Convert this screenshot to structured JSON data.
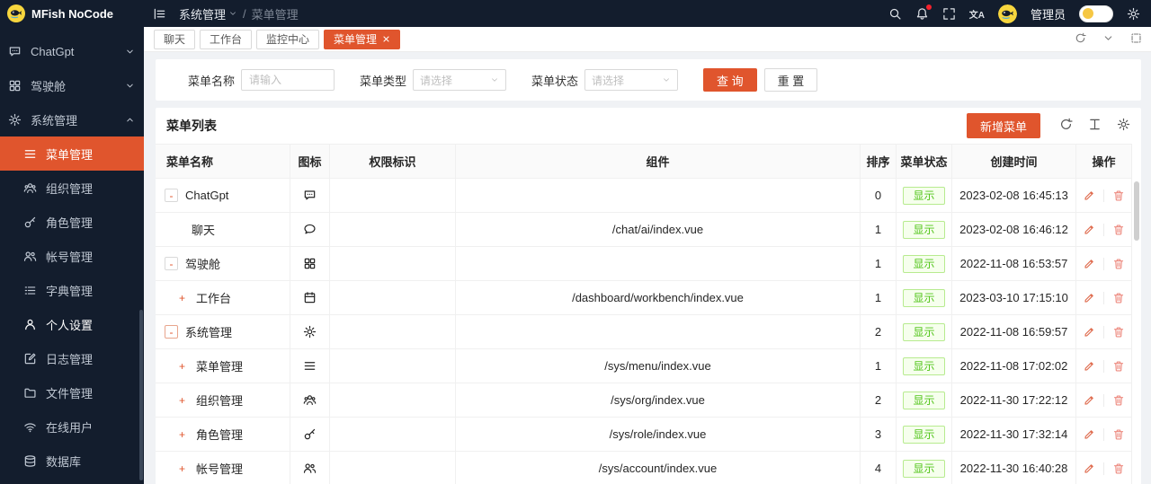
{
  "theme": {
    "primary": "#e0552d",
    "dark_bg": "#131d2d",
    "status_green": "#52c41a",
    "page_bg": "#f0f2f5"
  },
  "sidebar": {
    "logo_title": "MFish NoCode",
    "items": [
      {
        "label": "ChatGpt",
        "icon": "chat-dots",
        "chevron": "down"
      },
      {
        "label": "驾驶舱",
        "icon": "grid",
        "chevron": "down"
      },
      {
        "label": "系统管理",
        "icon": "gear",
        "chevron": "up",
        "children": [
          {
            "label": "菜单管理",
            "icon": "menu",
            "active": true
          },
          {
            "label": "组织管理",
            "icon": "org"
          },
          {
            "label": "角色管理",
            "icon": "role"
          },
          {
            "label": "帐号管理",
            "icon": "account"
          },
          {
            "label": "字典管理",
            "icon": "dict"
          },
          {
            "label": "个人设置",
            "icon": "person",
            "highlight": true
          },
          {
            "label": "日志管理",
            "icon": "log"
          },
          {
            "label": "文件管理",
            "icon": "folder"
          },
          {
            "label": "在线用户",
            "icon": "wifi"
          },
          {
            "label": "数据库",
            "icon": "database"
          }
        ]
      }
    ]
  },
  "topbar": {
    "breadcrumb_root": "系统管理",
    "breadcrumb_current": "菜单管理",
    "username": "管理员"
  },
  "tabbar": {
    "tabs": [
      {
        "label": "聊天"
      },
      {
        "label": "工作台"
      },
      {
        "label": "监控中心"
      },
      {
        "label": "菜单管理",
        "active": true
      }
    ]
  },
  "search": {
    "fields": [
      {
        "label": "菜单名称",
        "type": "input",
        "placeholder": "请输入"
      },
      {
        "label": "菜单类型",
        "type": "select",
        "placeholder": "请选择"
      },
      {
        "label": "菜单状态",
        "type": "select",
        "placeholder": "请选择"
      }
    ],
    "query_label": "查 询",
    "reset_label": "重 置"
  },
  "panel": {
    "title": "菜单列表",
    "add_button": "新增菜单"
  },
  "table": {
    "columns": [
      "菜单名称",
      "图标",
      "权限标识",
      "组件",
      "排序",
      "菜单状态",
      "创建时间",
      "操作"
    ],
    "rows": [
      {
        "name": "ChatGpt",
        "toggle": "minus",
        "box": "gray",
        "level": 0,
        "icon": "chat-dots",
        "permission": "",
        "component": "",
        "sort": "0",
        "status": "显示",
        "created": "2023-02-08 16:45:13"
      },
      {
        "name": "聊天",
        "toggle": "none",
        "box": "none",
        "level": 1,
        "icon": "chat",
        "permission": "",
        "component": "/chat/ai/index.vue",
        "sort": "1",
        "status": "显示",
        "created": "2023-02-08 16:46:12"
      },
      {
        "name": "驾驶舱",
        "toggle": "minus",
        "box": "gray",
        "level": 0,
        "icon": "grid",
        "permission": "",
        "component": "",
        "sort": "1",
        "status": "显示",
        "created": "2022-11-08 16:53:57"
      },
      {
        "name": "工作台",
        "toggle": "plus",
        "box": "none",
        "level": 1,
        "icon": "calendar",
        "permission": "",
        "component": "/dashboard/workbench/index.vue",
        "sort": "1",
        "status": "显示",
        "created": "2023-03-10 17:15:10"
      },
      {
        "name": "系统管理",
        "toggle": "minus",
        "box": "orange",
        "level": 0,
        "icon": "gear",
        "permission": "",
        "component": "",
        "sort": "2",
        "status": "显示",
        "created": "2022-11-08 16:59:57"
      },
      {
        "name": "菜单管理",
        "toggle": "plus",
        "box": "none",
        "level": 1,
        "icon": "menu",
        "permission": "",
        "component": "/sys/menu/index.vue",
        "sort": "1",
        "status": "显示",
        "created": "2022-11-08 17:02:02"
      },
      {
        "name": "组织管理",
        "toggle": "plus",
        "box": "none",
        "level": 1,
        "icon": "org",
        "permission": "",
        "component": "/sys/org/index.vue",
        "sort": "2",
        "status": "显示",
        "created": "2022-11-30 17:22:12"
      },
      {
        "name": "角色管理",
        "toggle": "plus",
        "box": "none",
        "level": 1,
        "icon": "role",
        "permission": "",
        "component": "/sys/role/index.vue",
        "sort": "3",
        "status": "显示",
        "created": "2022-11-30 17:32:14"
      },
      {
        "name": "帐号管理",
        "toggle": "plus",
        "box": "none",
        "level": 1,
        "icon": "account",
        "permission": "",
        "component": "/sys/account/index.vue",
        "sort": "4",
        "status": "显示",
        "created": "2022-11-30 16:40:28"
      }
    ]
  }
}
